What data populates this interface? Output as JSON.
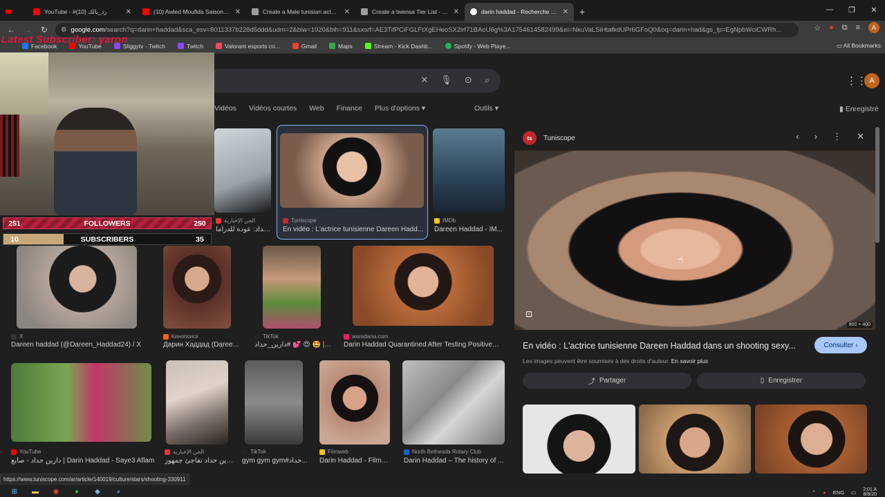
{
  "tabs": [
    {
      "title": "YouTube - #رد_بالك (10)",
      "favicon": "youtube-icon",
      "color": "#ff0000"
    },
    {
      "title": "(10) Awled Moufida Saison 01 E",
      "favicon": "youtube-icon",
      "color": "#ff0000"
    },
    {
      "title": "Create a Male tunisian actors Ti",
      "favicon": "tiermaker-icon",
      "color": "#9c9c9c"
    },
    {
      "title": "Create a twensa Tier List - Tier",
      "favicon": "tiermaker-icon",
      "color": "#9c9c9c"
    },
    {
      "title": "darin haddad - Recherche Goog",
      "favicon": "google-icon",
      "color": "#ffffff"
    }
  ],
  "address_bar": {
    "host": "google.com",
    "path": "/search?q=darin+haddad&sca_esv=8011337b228d5ddd&udm=2&biw=1920&bih=911&sxsrf=AE3TifPCiFGLFtXgEHeoSX2irf71BAoU6g%3A1754614582499&ei=NkuVaLSiHtafkdUPr6GFoQ0&oq=darin+had&gs_lp=EgNpbWciCWRh..."
  },
  "bookmarks": [
    {
      "label": "Facebook",
      "color": "#1877f2"
    },
    {
      "label": "YouTube",
      "color": "#ff0000"
    },
    {
      "label": "Sliggytv - Twitch",
      "color": "#9146ff"
    },
    {
      "label": "Twitch",
      "color": "#9146ff"
    },
    {
      "label": "Valorant esports co...",
      "color": "#ff4655"
    },
    {
      "label": "Gmail",
      "color": "#ea4335"
    },
    {
      "label": "Maps",
      "color": "#34a853"
    },
    {
      "label": "Stream - Kick Dashb...",
      "color": "#53fc18"
    },
    {
      "label": "Spotify - Web Playe...",
      "color": "#1db954"
    }
  ],
  "all_bookmarks": "All Bookmarks",
  "filters": [
    "Vidéos",
    "Vidéos courtes",
    "Web",
    "Finance",
    "Plus d'options ▾"
  ],
  "tools": "Outils ▾",
  "saved": "Enregistré",
  "account_initial": "A",
  "results": [
    {
      "source": "الجن الإخبارية",
      "caption": "دارين حداد: عودة للدراما",
      "src_color": "#e53935"
    },
    {
      "source": "Tuniscope",
      "caption": "En vidéo : L'actrice tunisienne Dareen Hadd...",
      "src_color": "#c0282e"
    },
    {
      "source": "IMDb",
      "caption": "Dareen Haddad - IM...",
      "src_color": "#f5c518"
    },
    {
      "source": "X",
      "caption": "Dareen haddad (@Dareen_Haddad24) / X",
      "src_color": "#000000"
    },
    {
      "source": "Кинопоиск",
      "caption": "Дарин Хаддад (Dareen H...",
      "src_color": "#ff6600"
    },
    {
      "source": "TikTok",
      "caption": "دارين_حداد# 💕 😍 🤩 | ...ok",
      "src_color": "#010101"
    },
    {
      "source": "waradana.com",
      "caption": "Darin Haddad Quarantined After Testing Positive f...",
      "src_color": "#e91e63"
    },
    {
      "source": "YouTube",
      "caption": "دارين حداد - صابع | Darin Haddad - Saye3 Aflam",
      "src_color": "#ff0000"
    },
    {
      "source": "الجن الإخبارية",
      "caption": "دارين حداد تفاجئ جمهور...",
      "src_color": "#e53935"
    },
    {
      "source": "TikTok",
      "caption": "gym gym gym#حداد...",
      "src_color": "#010101"
    },
    {
      "source": "Filmweb",
      "caption": "Darin Haddad - Filmw...",
      "src_color": "#f5c518"
    },
    {
      "source": "North Bethesda Rotary Club",
      "caption": "Darin Haddad – The history of ...",
      "src_color": "#1565c0"
    }
  ],
  "preview": {
    "source": "Tuniscope",
    "logo": "ts",
    "dims": "800 × 400",
    "title": "En vidéo : L'actrice tunisienne Dareen Haddad dans un shooting sexy...",
    "consult": "Consulter ›",
    "rights": "Les images peuvent être soumises à des droits d'auteur.",
    "learn_more": "En savoir plus",
    "share": "Partager",
    "save": "Enregistrer"
  },
  "overlay": {
    "latest": "Latest Subscriber: yaron",
    "followers": {
      "left": "251",
      "label": "FOLLOWERS",
      "right": "250",
      "progress": 0.98
    },
    "subscribers": {
      "left": "10",
      "label": "SUBSCRIBERS",
      "right": "35",
      "progress": 0.29
    }
  },
  "status_url": "https://www.tuniscope.com/ar/article/140019/culture/stars/shooting-330911",
  "tray": {
    "lang": "ENG",
    "time": "2:01 A",
    "date": "8/8/20"
  },
  "colors": {
    "accent": "#8ab4f8",
    "consult_bg": "#a8c7fa",
    "overlay_red": "#e0163c"
  }
}
